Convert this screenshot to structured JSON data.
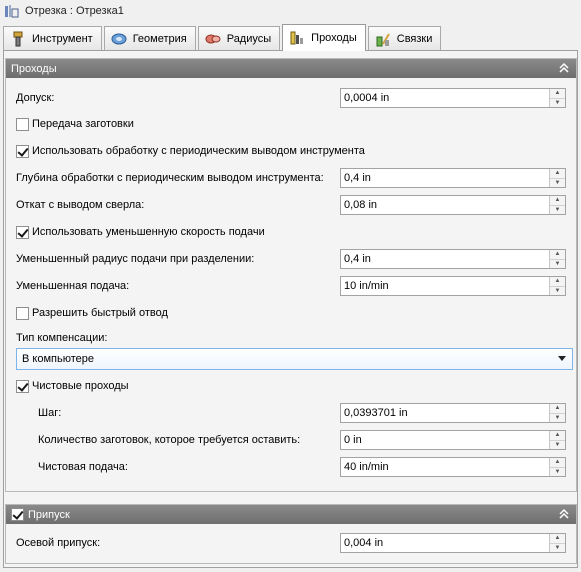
{
  "window": {
    "title": "Отрезка : Отрезка1"
  },
  "tabs": [
    {
      "label": "Инструмент"
    },
    {
      "label": "Геометрия"
    },
    {
      "label": "Радиусы"
    },
    {
      "label": "Проходы"
    },
    {
      "label": "Связки"
    }
  ],
  "passes": {
    "title": "Проходы",
    "tolerance_label": "Допуск:",
    "tolerance_value": "0,0004 in",
    "stock_transfer_label": "Передача заготовки",
    "peck_use_label": "Использовать обработку с периодическим выводом инструмента",
    "peck_depth_label": "Глубина обработки с периодическим выводом инструмента:",
    "peck_depth_value": "0,4 in",
    "chip_break_label": "Откат с выводом сверла:",
    "chip_break_value": "0,08 in",
    "reduced_feed_use_label": "Использовать уменьшенную скорость подачи",
    "reduced_radius_label": "Уменьшенный радиус подачи при разделении:",
    "reduced_radius_value": "0,4 in",
    "reduced_feed_label": "Уменьшенная подача:",
    "reduced_feed_value": "10 in/min",
    "rapid_retract_label": "Разрешить быстрый отвод",
    "compensation_label": "Тип компенсации:",
    "compensation_value": "В компьютере",
    "finishing_label": "Чистовые проходы",
    "stepover_label": "Шаг:",
    "stepover_value": "0,0393701 in",
    "stock_count_label": "Количество заготовок, которое требуется оставить:",
    "stock_count_value": "0 in",
    "finish_feed_label": "Чистовая подача:",
    "finish_feed_value": "40 in/min"
  },
  "allowance": {
    "title": "Припуск",
    "axial_label": "Осевой припуск:",
    "axial_value": "0,004 in"
  },
  "colors": {
    "header_bg": "#7a7a7a",
    "dropdown_border": "#7eb4ea"
  }
}
